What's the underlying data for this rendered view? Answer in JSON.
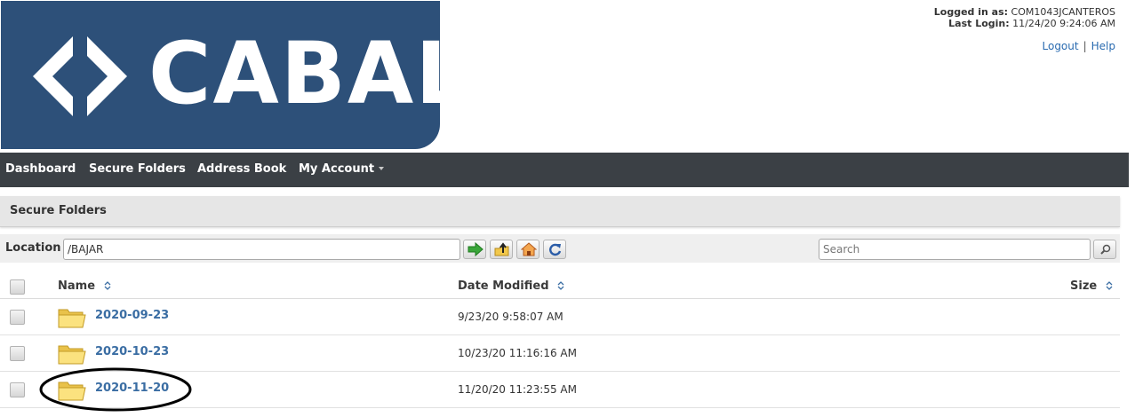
{
  "brand": {
    "name": "CABAL",
    "color": "#2d5079"
  },
  "login": {
    "logged_in_label": "Logged in as:",
    "user": "COM1043JCANTEROS",
    "last_login_label": "Last Login:",
    "last_login": "11/24/20 9:24:06 AM",
    "logout": "Logout",
    "separator": "|",
    "help": "Help"
  },
  "nav": {
    "items": [
      {
        "label": "Dashboard"
      },
      {
        "label": "Secure Folders"
      },
      {
        "label": "Address Book"
      },
      {
        "label": "My Account"
      }
    ]
  },
  "section": {
    "title": "Secure Folders"
  },
  "location": {
    "label": "Location",
    "value": "/BAJAR",
    "buttons": [
      "go-arrow-icon",
      "folder-up-icon",
      "home-icon",
      "refresh-icon"
    ],
    "search_placeholder": "Search"
  },
  "table": {
    "columns": {
      "name": "Name",
      "date": "Date Modified",
      "size": "Size"
    },
    "rows": [
      {
        "name": "2020-09-23",
        "date": "9/23/20 9:58:07 AM",
        "size": ""
      },
      {
        "name": "2020-10-23",
        "date": "10/23/20 11:16:16 AM",
        "size": ""
      },
      {
        "name": "2020-11-20",
        "date": "11/20/20 11:23:55 AM",
        "size": ""
      }
    ]
  },
  "colors": {
    "nav_bg": "#3b4045",
    "link": "#2a6bb0",
    "folder": "#f5d86a"
  }
}
